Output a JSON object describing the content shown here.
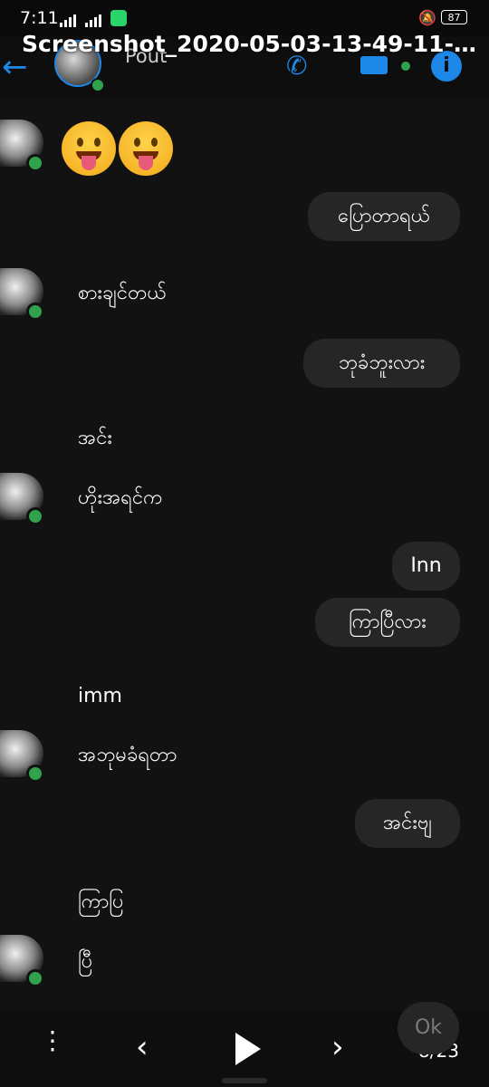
{
  "status_bar": {
    "time": "7:11",
    "battery": "87",
    "mute_icon": "bell-off-icon"
  },
  "header": {
    "contact_name": "Pout",
    "file_title": "Screenshot_2020-05-03-13-49-11-0...",
    "icons": [
      "back-arrow-icon",
      "phone-icon",
      "video-icon",
      "info-icon"
    ]
  },
  "messages": {
    "emojis": [
      "😛",
      "😛"
    ],
    "m1": "ပြောတာရယ်",
    "m2": "စားချင်တယ်",
    "m3": "ဘုခံဘူးလား",
    "m4": "အင်း",
    "m5": "ဟိုးအရင်က",
    "m6": "Inn",
    "m7": "ကြာပြီလား",
    "m8": "imm",
    "m9": "အဘုမခံရတာ",
    "m10": "အင်းဗျ",
    "m11": "ကြာပြ",
    "m12": "ပြီ",
    "m13": "Ok"
  },
  "viewer": {
    "page_indicator": "8/23"
  },
  "colors": {
    "accent": "#1c88e8",
    "online": "#31a24c",
    "bubble": "#262626",
    "background": "#121212"
  }
}
